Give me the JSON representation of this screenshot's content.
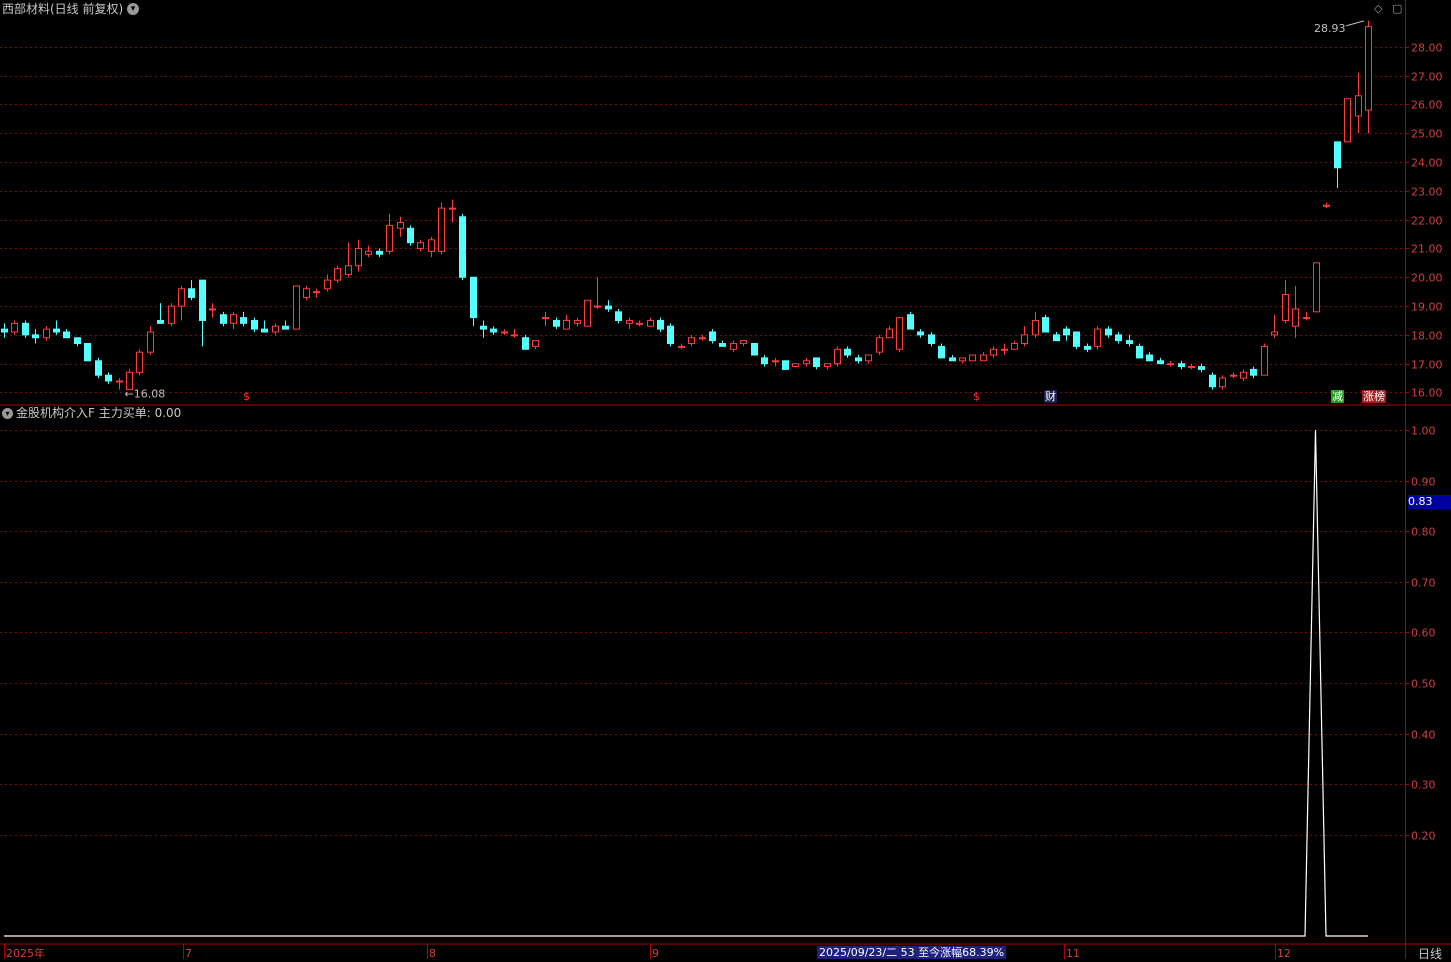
{
  "header": {
    "title": "西部材料(日线 前复权)",
    "dropdown_icon": "chevron-down-icon",
    "window_buttons": [
      "◇",
      "▢"
    ]
  },
  "indicator": {
    "title": "金股机构介入F  主力买单: 0.00",
    "current_value": "0.83"
  },
  "price_axis": {
    "labels": [
      "28.00",
      "27.00",
      "26.00",
      "25.00",
      "24.00",
      "23.00",
      "22.00",
      "21.00",
      "20.00",
      "19.00",
      "18.00",
      "17.00",
      "16.00"
    ]
  },
  "indicator_axis": {
    "labels": [
      "1.00",
      "0.90",
      "0.80",
      "0.70",
      "0.60",
      "0.50",
      "0.40",
      "0.30",
      "0.20"
    ]
  },
  "annotations": {
    "high_label": "28.93",
    "low_label": "16.08"
  },
  "event_tags": [
    {
      "text": "$",
      "color": "#ff3030",
      "bg": "transparent"
    },
    {
      "text": "$",
      "color": "#ff3030",
      "bg": "transparent"
    },
    {
      "text": "财",
      "color": "#ffffff",
      "bg": "#202050"
    },
    {
      "text": "减",
      "color": "#ffffff",
      "bg": "#20a020"
    },
    {
      "text": "涨榜",
      "color": "#ffffff",
      "bg": "#a02020"
    }
  ],
  "time_axis": {
    "labels": [
      "2025年",
      "7",
      "8",
      "9",
      "11",
      "12"
    ],
    "cursor_date": "2025/09/23/二 53 至今涨幅68.39%",
    "period": "日线"
  },
  "colors": {
    "up": "#ff3c3c",
    "down": "#54ffff",
    "grid": "#7a1010",
    "axis": "#b00000",
    "line": "#ffffff"
  },
  "chart_data": [
    {
      "type": "candlestick",
      "title": "西部材料(日线 前复权)",
      "series": [
        {
          "name": "西部材料",
          "ohlc": [
            [
              18.2,
              18.4,
              17.9,
              18.1
            ],
            [
              18.1,
              18.5,
              18.0,
              18.4
            ],
            [
              18.4,
              18.5,
              17.9,
              18.0
            ],
            [
              18.0,
              18.2,
              17.7,
              17.9
            ],
            [
              17.9,
              18.3,
              17.8,
              18.2
            ],
            [
              18.2,
              18.5,
              18.0,
              18.1
            ],
            [
              18.1,
              18.2,
              17.9,
              17.9
            ],
            [
              17.9,
              17.9,
              17.6,
              17.7
            ],
            [
              17.7,
              17.7,
              17.1,
              17.1
            ],
            [
              17.1,
              17.2,
              16.5,
              16.6
            ],
            [
              16.6,
              16.7,
              16.3,
              16.4
            ],
            [
              16.4,
              16.5,
              16.1,
              16.4
            ],
            [
              16.1,
              16.8,
              16.1,
              16.7
            ],
            [
              16.7,
              17.5,
              16.6,
              17.4
            ],
            [
              17.4,
              18.3,
              17.3,
              18.1
            ],
            [
              18.5,
              19.1,
              18.4,
              18.4
            ],
            [
              18.4,
              19.1,
              18.3,
              19.0
            ],
            [
              19.0,
              19.7,
              18.5,
              19.6
            ],
            [
              19.6,
              19.9,
              19.2,
              19.3
            ],
            [
              19.9,
              19.9,
              17.6,
              18.5
            ],
            [
              18.9,
              19.1,
              18.6,
              18.9
            ],
            [
              18.7,
              18.8,
              18.3,
              18.4
            ],
            [
              18.4,
              18.8,
              18.2,
              18.7
            ],
            [
              18.6,
              18.8,
              18.3,
              18.4
            ],
            [
              18.5,
              18.6,
              18.1,
              18.2
            ],
            [
              18.2,
              18.5,
              18.1,
              18.1
            ],
            [
              18.1,
              18.4,
              18.0,
              18.3
            ],
            [
              18.3,
              18.5,
              18.2,
              18.2
            ],
            [
              18.2,
              19.7,
              18.2,
              19.7
            ],
            [
              19.3,
              19.7,
              19.2,
              19.6
            ],
            [
              19.5,
              19.6,
              19.3,
              19.5
            ],
            [
              19.6,
              20.1,
              19.5,
              19.9
            ],
            [
              19.9,
              20.4,
              19.8,
              20.3
            ],
            [
              20.1,
              21.2,
              20.0,
              20.4
            ],
            [
              20.4,
              21.3,
              20.2,
              21.0
            ],
            [
              20.8,
              21.1,
              20.7,
              20.9
            ],
            [
              20.9,
              21.0,
              20.7,
              20.8
            ],
            [
              20.9,
              22.2,
              20.8,
              21.8
            ],
            [
              21.7,
              22.1,
              21.4,
              21.9
            ],
            [
              21.7,
              21.8,
              21.1,
              21.2
            ],
            [
              21.0,
              21.3,
              20.9,
              21.2
            ],
            [
              20.9,
              21.4,
              20.7,
              21.3
            ],
            [
              20.9,
              22.6,
              20.8,
              22.4
            ],
            [
              22.4,
              22.7,
              21.9,
              22.4
            ],
            [
              22.1,
              22.2,
              19.9,
              20.0
            ],
            [
              20.0,
              20.0,
              18.3,
              18.6
            ],
            [
              18.3,
              18.5,
              17.9,
              18.2
            ],
            [
              18.2,
              18.3,
              18.0,
              18.1
            ],
            [
              18.1,
              18.2,
              18.0,
              18.1
            ],
            [
              18.0,
              18.2,
              17.9,
              18.0
            ],
            [
              17.9,
              18.0,
              17.5,
              17.5
            ],
            [
              17.6,
              17.8,
              17.5,
              17.8
            ],
            [
              18.6,
              18.8,
              18.3,
              18.6
            ],
            [
              18.5,
              18.6,
              18.2,
              18.3
            ],
            [
              18.2,
              18.7,
              18.2,
              18.5
            ],
            [
              18.4,
              18.6,
              18.3,
              18.5
            ],
            [
              18.3,
              19.2,
              18.3,
              19.2
            ],
            [
              19.0,
              20.0,
              18.9,
              19.0
            ],
            [
              19.0,
              19.2,
              18.8,
              18.9
            ],
            [
              18.8,
              18.9,
              18.4,
              18.5
            ],
            [
              18.4,
              18.6,
              18.2,
              18.5
            ],
            [
              18.4,
              18.5,
              18.3,
              18.4
            ],
            [
              18.3,
              18.6,
              18.3,
              18.5
            ],
            [
              18.5,
              18.6,
              18.1,
              18.2
            ],
            [
              18.3,
              18.4,
              17.6,
              17.7
            ],
            [
              17.6,
              17.7,
              17.5,
              17.6
            ],
            [
              17.7,
              18.0,
              17.6,
              17.9
            ],
            [
              17.9,
              18.0,
              17.8,
              17.9
            ],
            [
              18.1,
              18.2,
              17.7,
              17.8
            ],
            [
              17.7,
              17.8,
              17.6,
              17.6
            ],
            [
              17.5,
              17.8,
              17.4,
              17.7
            ],
            [
              17.7,
              17.8,
              17.6,
              17.8
            ],
            [
              17.7,
              17.7,
              17.3,
              17.3
            ],
            [
              17.2,
              17.3,
              16.9,
              17.0
            ],
            [
              17.1,
              17.2,
              16.9,
              17.1
            ],
            [
              17.1,
              17.1,
              16.8,
              16.8
            ],
            [
              16.9,
              17.0,
              16.9,
              17.0
            ],
            [
              17.0,
              17.2,
              16.9,
              17.1
            ],
            [
              17.2,
              17.2,
              16.8,
              16.9
            ],
            [
              16.9,
              17.0,
              16.8,
              17.0
            ],
            [
              17.0,
              17.6,
              16.9,
              17.5
            ],
            [
              17.5,
              17.6,
              17.2,
              17.3
            ],
            [
              17.2,
              17.3,
              17.0,
              17.1
            ],
            [
              17.1,
              17.3,
              17.0,
              17.3
            ],
            [
              17.4,
              18.0,
              17.3,
              17.9
            ],
            [
              17.9,
              18.3,
              17.9,
              18.2
            ],
            [
              17.5,
              18.5,
              17.4,
              18.6
            ],
            [
              18.7,
              18.8,
              18.2,
              18.2
            ],
            [
              18.1,
              18.2,
              17.9,
              18.0
            ],
            [
              18.0,
              18.1,
              17.6,
              17.7
            ],
            [
              17.6,
              17.7,
              17.2,
              17.2
            ],
            [
              17.2,
              17.3,
              17.1,
              17.1
            ],
            [
              17.1,
              17.2,
              17.0,
              17.2
            ],
            [
              17.1,
              17.3,
              17.1,
              17.3
            ],
            [
              17.1,
              17.4,
              17.1,
              17.3
            ],
            [
              17.3,
              17.6,
              17.2,
              17.5
            ],
            [
              17.5,
              17.7,
              17.3,
              17.5
            ],
            [
              17.5,
              17.8,
              17.5,
              17.7
            ],
            [
              17.7,
              18.3,
              17.6,
              18.0
            ],
            [
              18.0,
              18.8,
              17.9,
              18.5
            ],
            [
              18.6,
              18.7,
              18.1,
              18.1
            ],
            [
              18.0,
              18.1,
              17.8,
              17.8
            ],
            [
              18.2,
              18.3,
              17.8,
              18.0
            ],
            [
              18.1,
              18.1,
              17.5,
              17.6
            ],
            [
              17.6,
              17.7,
              17.4,
              17.5
            ],
            [
              17.6,
              18.3,
              17.5,
              18.2
            ],
            [
              18.2,
              18.3,
              17.9,
              18.0
            ],
            [
              18.0,
              18.1,
              17.7,
              17.8
            ],
            [
              17.8,
              18.0,
              17.6,
              17.7
            ],
            [
              17.6,
              17.7,
              17.2,
              17.2
            ],
            [
              17.3,
              17.4,
              17.1,
              17.1
            ],
            [
              17.1,
              17.2,
              17.0,
              17.0
            ],
            [
              17.0,
              17.1,
              16.9,
              17.0
            ],
            [
              17.0,
              17.1,
              16.8,
              16.9
            ],
            [
              16.9,
              17.0,
              16.8,
              16.9
            ],
            [
              16.9,
              17.0,
              16.7,
              16.8
            ],
            [
              16.6,
              16.7,
              16.1,
              16.2
            ],
            [
              16.2,
              16.6,
              16.1,
              16.5
            ],
            [
              16.6,
              16.7,
              16.5,
              16.6
            ],
            [
              16.5,
              16.8,
              16.4,
              16.7
            ],
            [
              16.8,
              16.9,
              16.5,
              16.6
            ],
            [
              16.6,
              17.7,
              16.6,
              17.6
            ],
            [
              18.0,
              18.7,
              17.9,
              18.1
            ],
            [
              18.5,
              19.9,
              18.4,
              19.4
            ],
            [
              18.3,
              19.7,
              17.9,
              18.9
            ],
            [
              18.6,
              18.8,
              18.5,
              18.6
            ],
            [
              18.8,
              20.5,
              18.8,
              20.5
            ],
            [
              22.5,
              22.6,
              22.4,
              22.5
            ],
            [
              24.7,
              24.7,
              23.1,
              23.8
            ],
            [
              24.7,
              26.2,
              24.9,
              26.2
            ],
            [
              25.6,
              27.1,
              25.0,
              26.3
            ],
            [
              25.8,
              28.9,
              25.0,
              28.7
            ]
          ]
        }
      ],
      "ylim": [
        15.6,
        29.0
      ],
      "high": 28.93,
      "low": 16.08,
      "grid": true
    },
    {
      "type": "line",
      "title": "金股机构介入F",
      "series": [
        {
          "name": "主力买单",
          "values": [
            0,
            0,
            0,
            0,
            0,
            0,
            0,
            0,
            0,
            0,
            0,
            0,
            0,
            0,
            0,
            0,
            0,
            0,
            0,
            0,
            0,
            0,
            0,
            0,
            0,
            0,
            0,
            0,
            0,
            0,
            0,
            0,
            0,
            0,
            0,
            0,
            0,
            0,
            0,
            0,
            0,
            0,
            0,
            0,
            0,
            0,
            0,
            0,
            0,
            0,
            0,
            0,
            0,
            0,
            0,
            0,
            0,
            0,
            0,
            0,
            0,
            0,
            0,
            0,
            0,
            0,
            0,
            0,
            0,
            0,
            0,
            0,
            0,
            0,
            0,
            0,
            0,
            0,
            0,
            0,
            0,
            0,
            0,
            0,
            0,
            0,
            0,
            0,
            0,
            0,
            0,
            0,
            0,
            0,
            0,
            0,
            0,
            0,
            0,
            0,
            0,
            0,
            0,
            0,
            0,
            0,
            0,
            0,
            0,
            0,
            0,
            0,
            0,
            0,
            0,
            0,
            0,
            0,
            0,
            0,
            0,
            0,
            0,
            0,
            0,
            1,
            0,
            0,
            0,
            0,
            0
          ]
        }
      ],
      "ylim": [
        0.0,
        1.02
      ],
      "current": 0.83,
      "grid": true
    }
  ]
}
